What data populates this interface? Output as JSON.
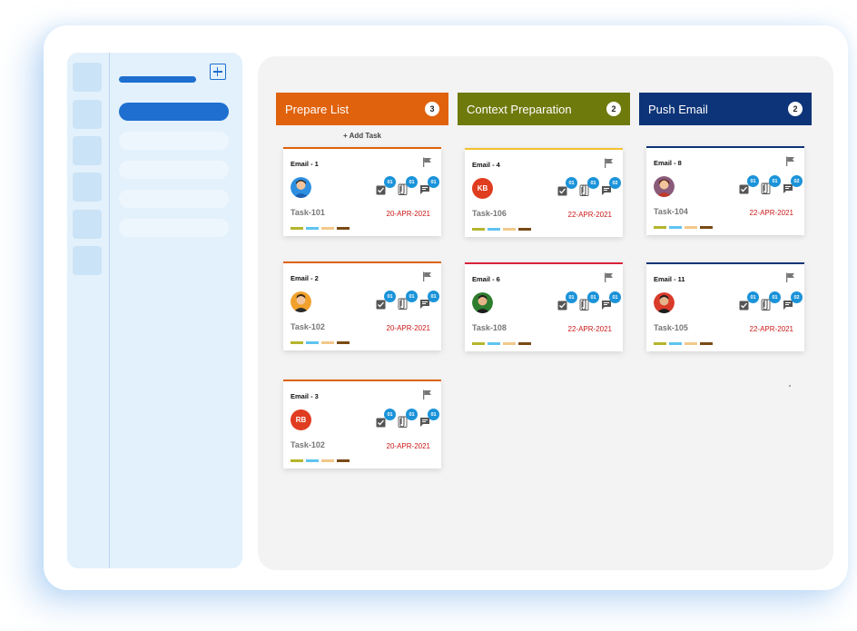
{
  "board": {
    "columns": [
      {
        "title": "Prepare List",
        "count": "3",
        "color": "#e0620c",
        "add_task": "+ Add Task",
        "cards": [
          {
            "title": "Email - 1",
            "assignee": {
              "type": "photo"
            },
            "badges": [
              "01",
              "01",
              "01"
            ],
            "task": "Task-101",
            "date": "20-APR-2021",
            "top_color": "#e0620c"
          },
          {
            "title": "Email - 2",
            "assignee": {
              "type": "photo"
            },
            "badges": [
              "01",
              "01",
              "01"
            ],
            "task": "Task-102",
            "date": "20-APR-2021",
            "top_color": "#e0620c"
          },
          {
            "title": "Email - 3",
            "assignee": {
              "type": "initials",
              "initials": "RB"
            },
            "badges": [
              "01",
              "01",
              "01"
            ],
            "task": "Task-102",
            "date": "20-APR-2021",
            "top_color": "#e0620c"
          }
        ]
      },
      {
        "title": "Context Preparation",
        "count": "2",
        "color": "#6f7a0c",
        "cards": [
          {
            "title": "Email - 4",
            "assignee": {
              "type": "initials",
              "initials": "KB"
            },
            "badges": [
              "01",
              "01",
              "02"
            ],
            "task": "Task-106",
            "date": "22-APR-2021",
            "top_color": "#f2c12e"
          },
          {
            "title": "Email - 6",
            "assignee": {
              "type": "photo"
            },
            "badges": [
              "01",
              "01",
              "01"
            ],
            "task": "Task-108",
            "date": "22-APR-2021",
            "top_color": "#d9223a"
          }
        ]
      },
      {
        "title": "Push Email",
        "count": "2",
        "color": "#0d3478",
        "cards": [
          {
            "title": "Email - 8",
            "assignee": {
              "type": "photo"
            },
            "badges": [
              "01",
              "01",
              "02"
            ],
            "task": "Task-104",
            "date": "22-APR-2021",
            "top_color": "#0d3478"
          },
          {
            "title": "Email - 11",
            "assignee": {
              "type": "photo"
            },
            "badges": [
              "01",
              "01",
              "02"
            ],
            "task": "Task-105",
            "date": "22-APR-2021",
            "top_color": "#0d3478"
          }
        ]
      }
    ],
    "label_colors": [
      "#b5b52e",
      "#5ec4f0",
      "#f2c88a",
      "#7a4a14"
    ]
  },
  "icons": {
    "card_icons": [
      "checklist-icon",
      "attachment-icon",
      "comment-icon"
    ],
    "card_flag": "flag-icon",
    "sidebar_add": "add-page-icon"
  }
}
